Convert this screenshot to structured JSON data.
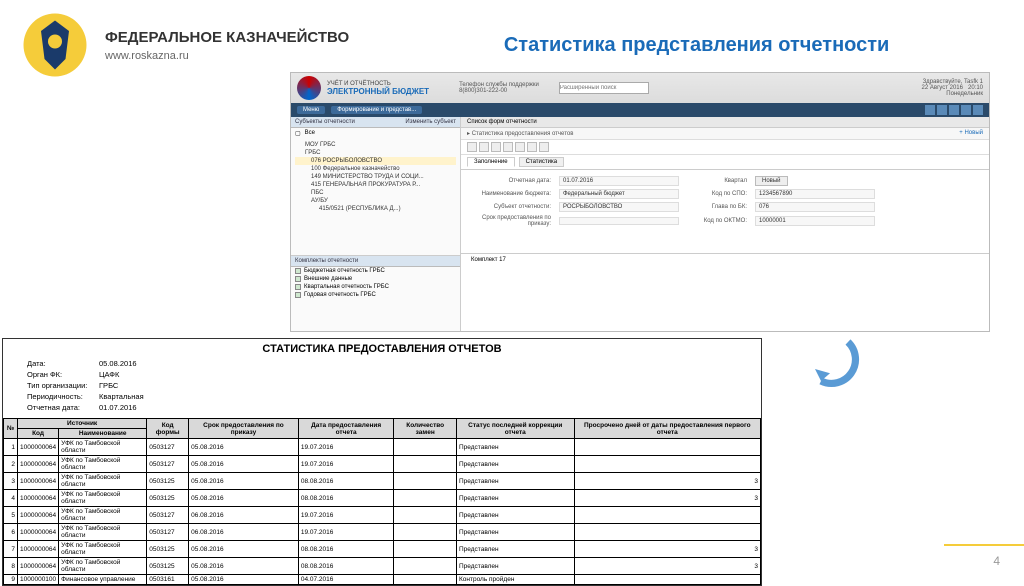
{
  "header": {
    "org_title": "ФЕДЕРАЛЬНОЕ КАЗНАЧЕЙСТВО",
    "url": "www.roskazna.ru",
    "page_title": "Статистика представления отчетности"
  },
  "app": {
    "brand_small": "УЧЁТ И ОТЧЁТНОСТЬ",
    "brand": "ЭЛЕКТРОННЫЙ БЮДЖЕТ",
    "phone_lbl": "Телефон службы поддержки",
    "phone": "8(800)301-222-00",
    "search_placeholder": "Расширенный поиск",
    "greeting": "Здравствуйте, Tasfk 1",
    "date": "22 Август 2016",
    "day": "Понедельник",
    "time": "20:10",
    "toolbar": {
      "menu": "Меню",
      "form": "Формирование и представ..."
    },
    "side_title": "Субъекты отчетности",
    "side_title2": "Изменить субъект",
    "vse": "Все",
    "tree": [
      "МОУ ГРБС",
      "ГРБС",
      "076 РОСРЫБОЛОВСТВО",
      "100 Федеральное казначейство",
      "149 МИНИСТЕРСТВО ТРУДА И СОЦИ...",
      "415 ГЕНЕРАЛЬНАЯ ПРОКУРАТУРА Р...",
      "ПБС",
      "АУ/БУ",
      "415/0521 (РЕСПУБЛИКА Д...)"
    ],
    "side2_title": "Комплекты отчетности",
    "checks": [
      "Бюджетная отчетность ГРБС",
      "Внешние данные",
      "Квартальная отчетность ГРБС",
      "Годовая отчетность ГРБС"
    ],
    "main_title": "Список форм отчетности",
    "crumb": "Статистика предоставления отчетов",
    "crumb_new": "+ Новый",
    "tab1": "Заполнение",
    "tab2": "Статистика",
    "form": {
      "l_date": "Отчетная дата:",
      "v_date": "01.07.2016",
      "l_q": "Квартал",
      "btn_new": "Новый",
      "l_budget": "Наименование бюджета:",
      "v_budget": "Федеральный бюджет",
      "l_subj": "Субъект отчетности:",
      "v_subj": "РОСРЫБОЛОВСТВО",
      "l_srok": "Срок предоставления по приказу:",
      "l_spo": "Код по СПО:",
      "v_spo": "1234567890",
      "l_pbs": "Глава по БК:",
      "v_pbs": "076",
      "l_oktmo": "Код по ОКТМО:",
      "v_oktmo": "10000001",
      "bottom": "Комплект 17"
    }
  },
  "report": {
    "title": "СТАТИСТИКА ПРЕДОСТАВЛЕНИЯ ОТЧЕТОВ",
    "meta": {
      "date_lbl": "Дата:",
      "date": "05.08.2016",
      "organ_lbl": "Орган ФК:",
      "organ": "ЦАФК",
      "type_lbl": "Тип организации:",
      "type": "ГРБС",
      "period_lbl": "Периодичность:",
      "period": "Квартальная",
      "repdate_lbl": "Отчетная дата:",
      "repdate": "01.07.2016"
    },
    "headers": {
      "num": "№",
      "src": "Источник",
      "kod": "Код",
      "name": "Наименование",
      "form": "Код формы",
      "srok": "Срок предоставления по приказу",
      "pdate": "Дата предоставления отчета",
      "zamen": "Количество замен",
      "status": "Статус последней коррекции отчета",
      "over": "Просрочено дней от даты предоставления первого отчета"
    },
    "rows": [
      {
        "n": "1",
        "kod": "1000000064",
        "name": "УФК по Тамбовской области",
        "form": "0503127",
        "srok": "05.08.2016",
        "pdate": "19.07.2016",
        "zam": "",
        "status": "Представлен",
        "over": ""
      },
      {
        "n": "2",
        "kod": "1000000064",
        "name": "УФК по Тамбовской области",
        "form": "0503127",
        "srok": "05.08.2016",
        "pdate": "19.07.2016",
        "zam": "",
        "status": "Представлен",
        "over": ""
      },
      {
        "n": "3",
        "kod": "1000000064",
        "name": "УФК по Тамбовской области",
        "form": "0503125",
        "srok": "05.08.2016",
        "pdate": "08.08.2016",
        "zam": "",
        "status": "Представлен",
        "over": "3"
      },
      {
        "n": "4",
        "kod": "1000000064",
        "name": "УФК по Тамбовской области",
        "form": "0503125",
        "srok": "05.08.2016",
        "pdate": "08.08.2016",
        "zam": "",
        "status": "Представлен",
        "over": "3"
      },
      {
        "n": "5",
        "kod": "1000000064",
        "name": "УФК по Тамбовской области",
        "form": "0503127",
        "srok": "06.08.2016",
        "pdate": "19.07.2016",
        "zam": "",
        "status": "Представлен",
        "over": ""
      },
      {
        "n": "6",
        "kod": "1000000064",
        "name": "УФК по Тамбовской области",
        "form": "0503127",
        "srok": "06.08.2016",
        "pdate": "19.07.2016",
        "zam": "",
        "status": "Представлен",
        "over": ""
      },
      {
        "n": "7",
        "kod": "1000000064",
        "name": "УФК по Тамбовской области",
        "form": "0503125",
        "srok": "05.08.2016",
        "pdate": "08.08.2016",
        "zam": "",
        "status": "Представлен",
        "over": "3"
      },
      {
        "n": "8",
        "kod": "1000000064",
        "name": "УФК по Тамбовской области",
        "form": "0503125",
        "srok": "05.08.2016",
        "pdate": "08.08.2016",
        "zam": "",
        "status": "Представлен",
        "over": "3"
      },
      {
        "n": "9",
        "kod": "1000000100",
        "name": "Финансовое управление",
        "form": "0503161",
        "srok": "05.08.2016",
        "pdate": "04.07.2016",
        "zam": "",
        "status": "Контроль пройден",
        "over": ""
      }
    ]
  },
  "pagenum": "4"
}
